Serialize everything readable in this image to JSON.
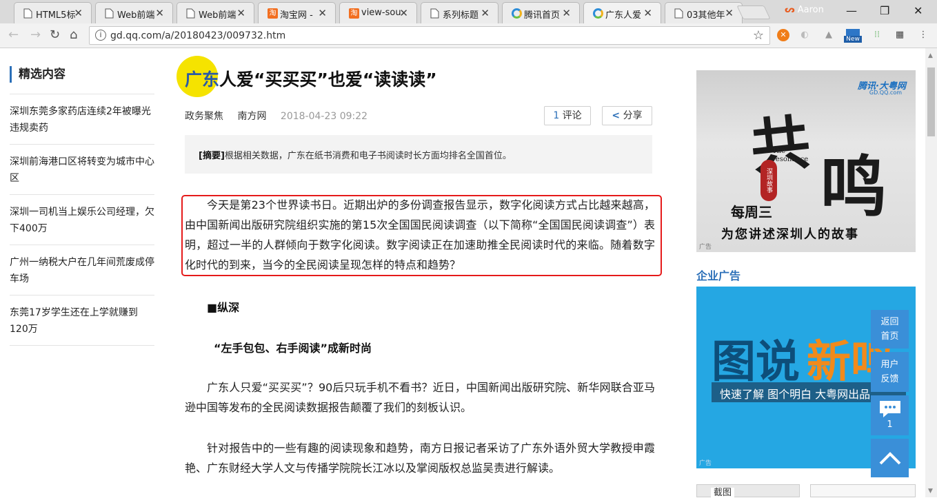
{
  "browser": {
    "tabs": [
      {
        "title": "HTML5标",
        "icon": "page"
      },
      {
        "title": "Web前端",
        "icon": "page"
      },
      {
        "title": "Web前端",
        "icon": "page"
      },
      {
        "title": "淘宝网 -",
        "icon": "taobao"
      },
      {
        "title": "view-sou",
        "icon": "taobao"
      },
      {
        "title": "系列标题",
        "icon": "page"
      },
      {
        "title": "腾讯首页",
        "icon": "qq"
      },
      {
        "title": "广东人爱",
        "icon": "qq"
      },
      {
        "title": "03其他年",
        "icon": "page"
      }
    ],
    "active_tab_index": 7,
    "profile_name": "Aaron",
    "url": "gd.qq.com/a/20180423/009732.htm",
    "ext_new_badge": "New"
  },
  "sidebar": {
    "title": "精选内容",
    "items": [
      "深圳东莞多家药店连续2年被曝光违规卖药",
      "深圳前海港口区将转变为城市中心区",
      "深圳一司机当上娱乐公司经理，欠下400万",
      "广州一纳税大户在几年间荒废成停车场",
      "东莞17岁学生还在上学就赚到120万"
    ]
  },
  "article": {
    "title_hl": "广东",
    "title_rest": "人爱“买买买”也爱“读读读”",
    "category": "政务聚焦",
    "source": "南方网",
    "datetime": "2018-04-23 09:22",
    "comment_count": "1",
    "comment_label": "评论",
    "share_label": "分享",
    "summary_label": "[摘要]",
    "summary": "根据相关数据，广东在纸书消费和电子书阅读时长方面均排名全国首位。",
    "para1": "今天是第23个世界读书日。近期出炉的多份调查报告显示，数字化阅读方式占比越来越高，由中国新闻出版研究院组织实施的第15次全国国民阅读调查（以下简称“全国国民阅读调查”）表明，超过一半的人群倾向于数字化阅读。数字阅读正在加速助推全民阅读时代的来临。随着数字化时代的到来，当今的全民阅读呈现怎样的特点和趋势？",
    "section1": "■纵深",
    "section2": "“左手包包、右手阅读”成新时尚",
    "para2": "广东人只爱“买买买”？90后只玩手机不看书？近日，中国新闻出版研究院、新华网联合亚马逊中国等发布的全民阅读数据报告颠覆了我们的刻板认识。",
    "para3": "针对报告中的一些有趣的阅读现象和趋势，南方日报记者采访了广东外语外贸大学教授申霞艳、广东财经大学人文与传播学院院长江冰以及掌阅版权总监吴责进行解读。"
  },
  "ads": {
    "ad1_logo": "腾讯·大粤网",
    "ad1_logo_sub": "GD.QQ.com",
    "ad1_big1": "共",
    "ad1_big2": "鸣",
    "ad1_eng": "The resonance",
    "ad1_seal": "深圳故事",
    "ad1_week": "每周三",
    "ad1_tagline": "为您讲述深圳人的故事",
    "ad_mark": "广告",
    "enterprise_title": "企业广告",
    "ad2_c1": "图说",
    "ad2_c2": "新鸣",
    "ad2_strip": "快速了解  图个明白  大粤网出品",
    "bottom_thumb_1": "截图"
  },
  "floating": {
    "home_line1": "返回",
    "home_line2": "首页",
    "feedback_line1": "用户",
    "feedback_line2": "反馈",
    "comment_count": "1"
  }
}
